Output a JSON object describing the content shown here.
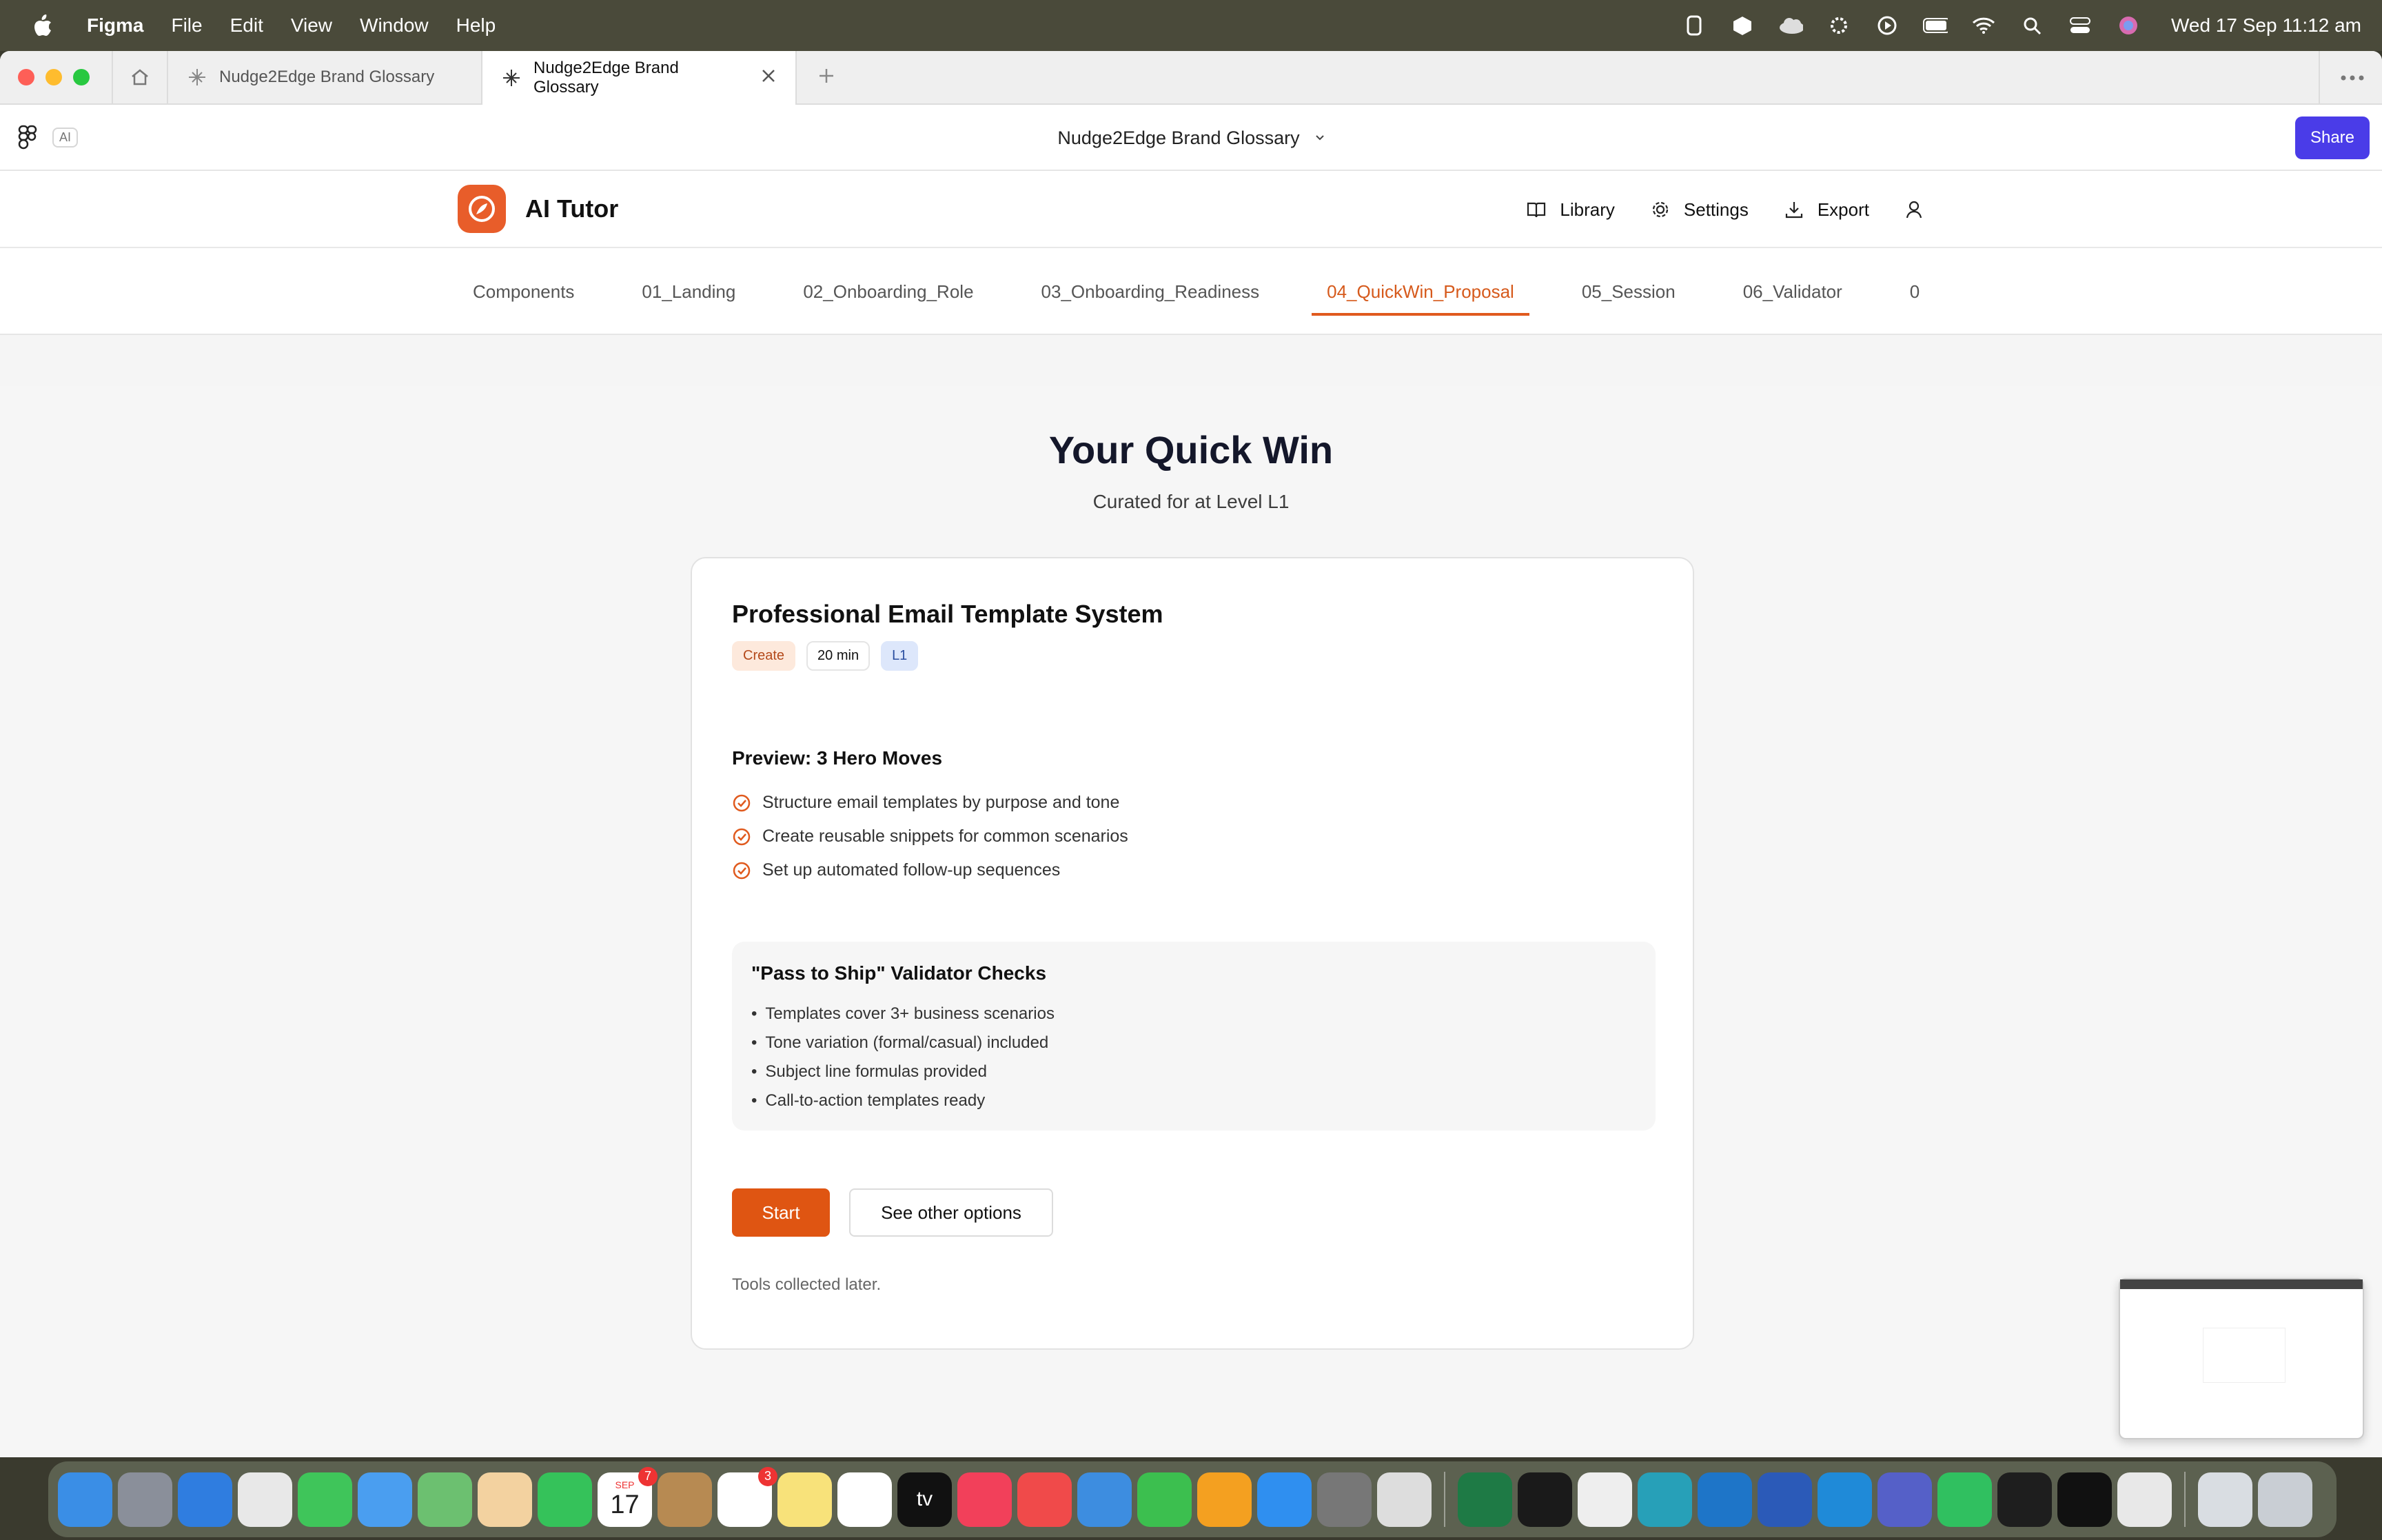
{
  "menubar": {
    "app_name": "Figma",
    "menus": [
      "File",
      "Edit",
      "View",
      "Window",
      "Help"
    ],
    "clock": "Wed 17 Sep  11:12 am"
  },
  "browser": {
    "tabs": [
      {
        "label": "Nudge2Edge Brand Glossary",
        "active": false
      },
      {
        "label": "Nudge2Edge Brand Glossary",
        "active": true
      }
    ]
  },
  "figma": {
    "ai_badge": "AI",
    "file_title": "Nudge2Edge Brand Glossary",
    "share_label": "Share"
  },
  "app": {
    "brand_name": "AI Tutor",
    "brand_color": "#e85d2a",
    "actions": {
      "library": "Library",
      "settings": "Settings",
      "export": "Export"
    },
    "nav_tabs": [
      "Components",
      "01_Landing",
      "02_Onboarding_Role",
      "03_Onboarding_Readiness",
      "04_QuickWin_Proposal",
      "05_Session",
      "06_Validator",
      "0"
    ],
    "active_tab": "04_QuickWin_Proposal"
  },
  "page": {
    "title": "Your Quick Win",
    "subtitle": "Curated for at Level L1",
    "card": {
      "title": "Professional Email Template System",
      "tags": {
        "type": "Create",
        "duration": "20 min",
        "level": "L1"
      },
      "preview_title": "Preview: 3 Hero Moves",
      "moves": [
        "Structure email templates by purpose and tone",
        "Create reusable snippets for common scenarios",
        "Set up automated follow-up sequences"
      ],
      "validator_title": "\"Pass to Ship\" Validator Checks",
      "validator_checks": [
        "Templates cover 3+ business scenarios",
        "Tone variation (formal/casual) included",
        "Subject line formulas provided",
        "Call-to-action templates ready"
      ],
      "start_label": "Start",
      "other_label": "See other options",
      "footnote": "Tools collected later."
    }
  },
  "dock": {
    "calendar_month": "SEP",
    "calendar_day": "17",
    "calendar_badge": "7",
    "reminders_badge": "3",
    "tv_label": "tv"
  }
}
